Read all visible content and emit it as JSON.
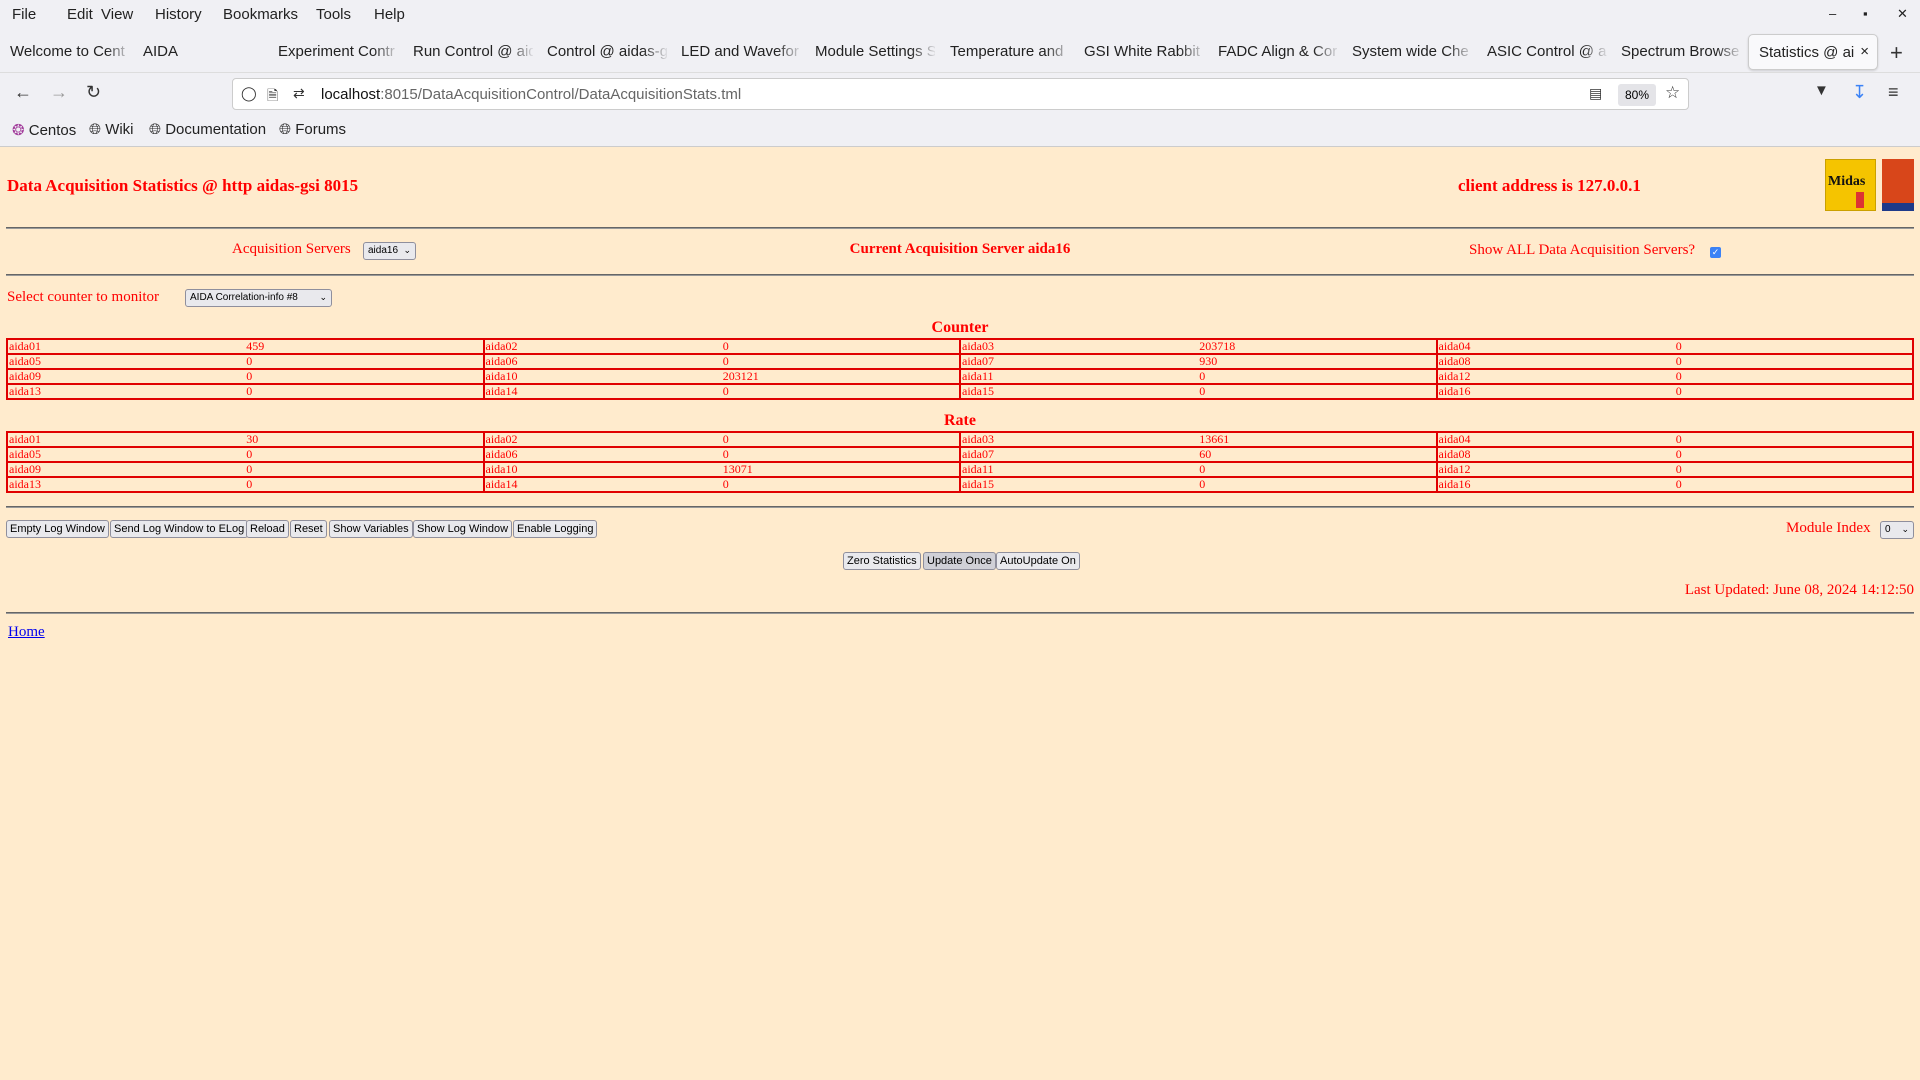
{
  "browser": {
    "menu": [
      "File",
      "Edit",
      "View",
      "History",
      "Bookmarks",
      "Tools",
      "Help"
    ],
    "tabs": [
      "Welcome to Cent",
      "AIDA",
      "Experiment Contr",
      "Run Control @ aid",
      "Control @ aidas-g",
      "LED and Wavefor",
      "Module Settings S",
      "Temperature and",
      "GSI White Rabbit",
      "FADC Align & Cor",
      "System wide Che",
      "ASIC Control @ a",
      "Spectrum Browse",
      "Statistics @ aid"
    ],
    "active_tab": 13,
    "url_host": "localhost",
    "url_rest": ":8015/DataAcquisitionControl/DataAcquisitionStats.tml",
    "zoom": "80%",
    "bookmarks": [
      "Centos",
      "Wiki",
      "Documentation",
      "Forums"
    ]
  },
  "page": {
    "title": "Data Acquisition Statistics @ http aidas-gsi 8015",
    "client": "client address is 127.0.0.1",
    "logos": [
      "Midas",
      "TCL"
    ],
    "acq_label": "Acquisition Servers",
    "acq_value": "aida16",
    "current_server": "Current Acquisition Server aida16",
    "show_all_label": "Show ALL Data Acquisition Servers?",
    "show_all_checked": true,
    "counter_label": "Select counter to monitor",
    "counter_value": "AIDA Correlation-info #8",
    "counter_heading": "Counter",
    "rate_heading": "Rate",
    "counter": [
      [
        [
          "aida01",
          "459"
        ],
        [
          "aida02",
          "0"
        ],
        [
          "aida03",
          "203718"
        ],
        [
          "aida04",
          "0"
        ]
      ],
      [
        [
          "aida05",
          "0"
        ],
        [
          "aida06",
          "0"
        ],
        [
          "aida07",
          "930"
        ],
        [
          "aida08",
          "0"
        ]
      ],
      [
        [
          "aida09",
          "0"
        ],
        [
          "aida10",
          "203121"
        ],
        [
          "aida11",
          "0"
        ],
        [
          "aida12",
          "0"
        ]
      ],
      [
        [
          "aida13",
          "0"
        ],
        [
          "aida14",
          "0"
        ],
        [
          "aida15",
          "0"
        ],
        [
          "aida16",
          "0"
        ]
      ]
    ],
    "rate": [
      [
        [
          "aida01",
          "30"
        ],
        [
          "aida02",
          "0"
        ],
        [
          "aida03",
          "13661"
        ],
        [
          "aida04",
          "0"
        ]
      ],
      [
        [
          "aida05",
          "0"
        ],
        [
          "aida06",
          "0"
        ],
        [
          "aida07",
          "60"
        ],
        [
          "aida08",
          "0"
        ]
      ],
      [
        [
          "aida09",
          "0"
        ],
        [
          "aida10",
          "13071"
        ],
        [
          "aida11",
          "0"
        ],
        [
          "aida12",
          "0"
        ]
      ],
      [
        [
          "aida13",
          "0"
        ],
        [
          "aida14",
          "0"
        ],
        [
          "aida15",
          "0"
        ],
        [
          "aida16",
          "0"
        ]
      ]
    ],
    "buttons": [
      "Empty Log Window",
      "Send Log Window to ELog",
      "Reload",
      "Reset",
      "Show Variables",
      "Show Log Window",
      "Enable Logging"
    ],
    "module_index_label": "Module Index",
    "module_index_value": "0",
    "buttons2": [
      "Zero Statistics",
      "Update Once",
      "AutoUpdate On"
    ],
    "last_updated": "Last Updated: June 08, 2024 14:12:50",
    "home": "Home"
  },
  "colors": {
    "text": "#ff0000",
    "background": "#ffebcd",
    "link": "#0000ee"
  }
}
